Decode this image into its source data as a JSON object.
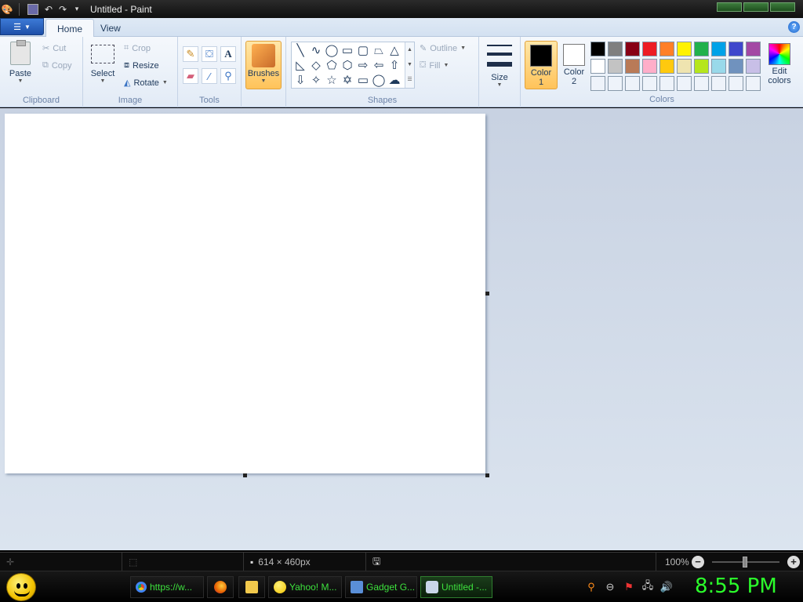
{
  "window": {
    "title": "Untitled - Paint",
    "quick_access": [
      "save-icon",
      "undo-icon",
      "redo-icon",
      "customize-icon"
    ]
  },
  "ribbon": {
    "tabs": [
      {
        "label": "Home",
        "active": true
      },
      {
        "label": "View",
        "active": false
      }
    ],
    "clipboard": {
      "label": "Clipboard",
      "paste": "Paste",
      "cut": "Cut",
      "copy": "Copy"
    },
    "image": {
      "label": "Image",
      "select": "Select",
      "crop": "Crop",
      "resize": "Resize",
      "rotate": "Rotate"
    },
    "tools": {
      "label": "Tools",
      "items": [
        "pencil-icon",
        "fill-icon",
        "text-icon",
        "eraser-icon",
        "color-picker-icon",
        "magnifier-icon"
      ]
    },
    "brushes": {
      "label": "Brushes"
    },
    "shapes": {
      "label": "Shapes",
      "outline": "Outline",
      "fill": "Fill"
    },
    "size": {
      "label": "Size"
    },
    "colors": {
      "label": "Colors",
      "color1_label_line1": "Color",
      "color1_label_line2": "1",
      "color2_label_line1": "Color",
      "color2_label_line2": "2",
      "color1_value": "#000000",
      "color2_value": "#ffffff",
      "edit_line1": "Edit",
      "edit_line2": "colors",
      "palette": [
        "#000000",
        "#7f7f7f",
        "#880015",
        "#ed1c24",
        "#ff7f27",
        "#fff200",
        "#22b14c",
        "#00a2e8",
        "#3f48cc",
        "#a349a4",
        "#ffffff",
        "#c3c3c3",
        "#b97a57",
        "#ffaec9",
        "#ffc90e",
        "#efe4b0",
        "#b5e61d",
        "#99d9ea",
        "#7092be",
        "#c8bfe7",
        "#eef3fa",
        "#eef3fa",
        "#eef3fa",
        "#eef3fa",
        "#eef3fa",
        "#eef3fa",
        "#eef3fa",
        "#eef3fa",
        "#eef3fa",
        "#eef3fa"
      ]
    }
  },
  "statusbar": {
    "dimensions": "614 × 460px",
    "zoom": "100%"
  },
  "taskbar": {
    "tasks": [
      {
        "label": "https://w...",
        "icon": "chrome-icon",
        "color": "#4a8af4"
      },
      {
        "label": "",
        "icon": "firefox-icon",
        "color": "#e66000"
      },
      {
        "label": "",
        "icon": "folder-icon",
        "color": "#f2c94c"
      },
      {
        "label": "Yahoo! M...",
        "icon": "yahoo-messenger-icon",
        "color": "#f5c400"
      },
      {
        "label": "Gadget G...",
        "icon": "gadget-icon",
        "color": "#5a8fd8"
      },
      {
        "label": "Untitled -...",
        "icon": "paint-icon",
        "color": "#c9d6e8",
        "active": true
      }
    ],
    "clock": "8:55 PM"
  }
}
